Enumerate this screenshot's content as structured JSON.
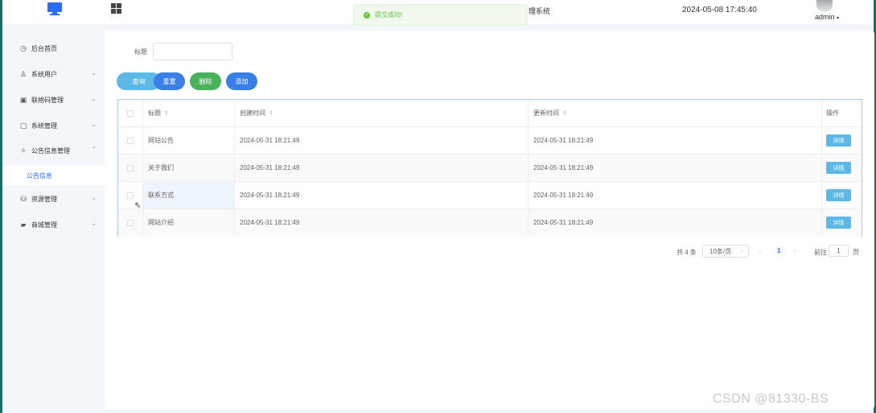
{
  "header": {
    "system_title": "理系统",
    "datetime": "2024-05-08 17:45:40",
    "username": "admin",
    "caret": "▾"
  },
  "toast": {
    "message": "提交成功!"
  },
  "sidebar": {
    "items": [
      {
        "label": "后台首页",
        "icon": "clock-icon",
        "glyph": "◷"
      },
      {
        "label": "系统用户",
        "icon": "user-icon",
        "glyph": "♙"
      },
      {
        "label": "联络码管理",
        "icon": "card-icon",
        "glyph": "▣"
      },
      {
        "label": "系统管理",
        "icon": "folder-icon",
        "glyph": "▢"
      },
      {
        "label": "公告信息管理",
        "icon": "announce-icon",
        "glyph": "✧"
      },
      {
        "label": "公告信息",
        "icon": "",
        "glyph": ""
      },
      {
        "label": "资源管理",
        "icon": "ticket-icon",
        "glyph": "⛁"
      },
      {
        "label": "商城管理",
        "icon": "shop-icon",
        "glyph": "▰"
      }
    ],
    "chevron_down": "⌄",
    "chevron_up": "⌃"
  },
  "search": {
    "label": "标题",
    "value": "",
    "placeholder": ""
  },
  "buttons": {
    "query": "查询",
    "reset": "重置",
    "delete": "删除",
    "add": "添加"
  },
  "table": {
    "columns": {
      "title": "标题",
      "created": "创建时间",
      "updated": "更新时间",
      "operation": "操作"
    },
    "sort_glyph": "⇕",
    "detail_label": "详情",
    "rows": [
      {
        "title": "网站公告",
        "created": "2024-05-31 18:21:49",
        "updated": "2024-05-31 18:21:49"
      },
      {
        "title": "关于我们",
        "created": "2024-05-31 18:21:49",
        "updated": "2024-05-31 18:21:49"
      },
      {
        "title": "联系方式",
        "created": "2024-05-31 18:21:49",
        "updated": "2024-05-31 18:21:49"
      },
      {
        "title": "网站介绍",
        "created": "2024-05-31 18:21:49",
        "updated": "2024-05-31 18:21:49"
      }
    ]
  },
  "pagination": {
    "total": "共 4 条",
    "page_size": "10条/页",
    "prev": "‹",
    "current": "1",
    "next": "›",
    "goto_label": "前往",
    "goto_value": "1",
    "unit": "页"
  },
  "watermark": "CSDN @81330-BS",
  "colors": {
    "primary": "#2d6ef0",
    "success": "#49b35c",
    "info": "#5cb8e6",
    "toast_bg": "#f0f9eb"
  }
}
